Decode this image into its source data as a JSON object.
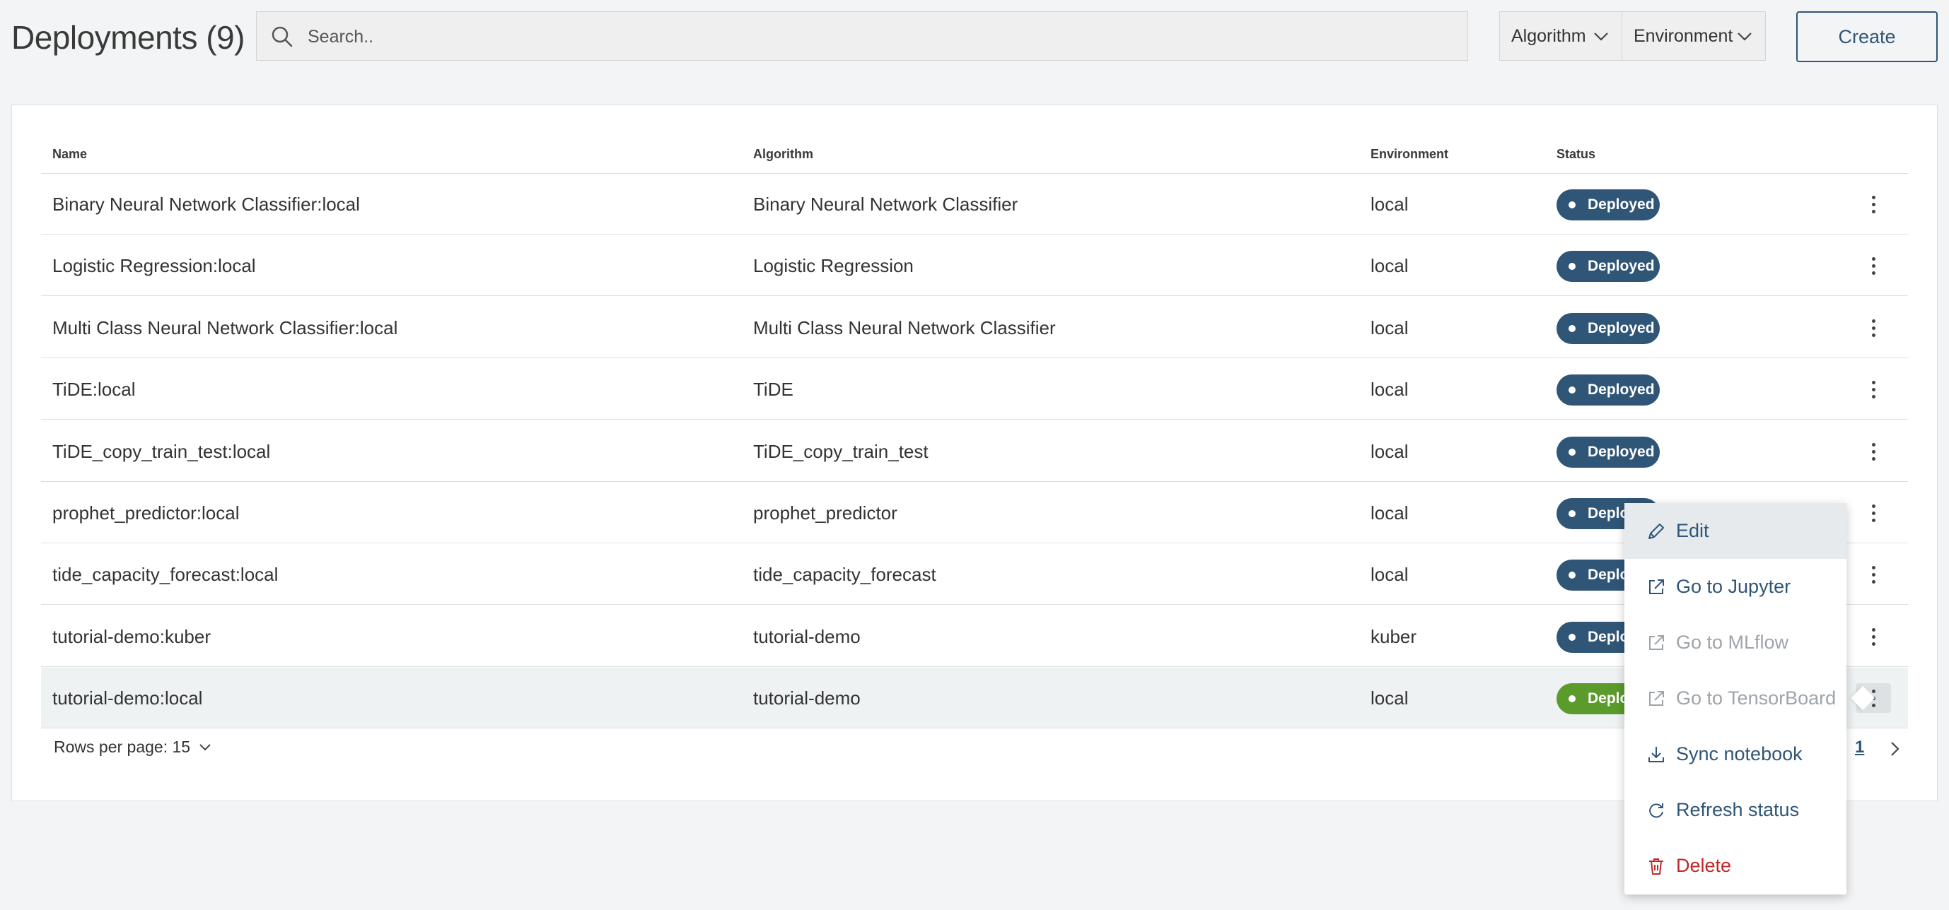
{
  "header": {
    "title": "Deployments (9)",
    "search_placeholder": "Search..",
    "filter_algorithm": "Algorithm",
    "filter_environment": "Environment",
    "create_label": "Create"
  },
  "table": {
    "columns": [
      "Name",
      "Algorithm",
      "Environment",
      "Status"
    ],
    "rows": [
      {
        "name": "Binary Neural Network Classifier:local",
        "algorithm": "Binary Neural Network Classifier",
        "environment": "local",
        "status": "Deployed"
      },
      {
        "name": "Logistic Regression:local",
        "algorithm": "Logistic Regression",
        "environment": "local",
        "status": "Deployed"
      },
      {
        "name": "Multi Class Neural Network Classifier:local",
        "algorithm": "Multi Class Neural Network Classifier",
        "environment": "local",
        "status": "Deployed"
      },
      {
        "name": "TiDE:local",
        "algorithm": "TiDE",
        "environment": "local",
        "status": "Deployed"
      },
      {
        "name": "TiDE_copy_train_test:local",
        "algorithm": "TiDE_copy_train_test",
        "environment": "local",
        "status": "Deployed"
      },
      {
        "name": "prophet_predictor:local",
        "algorithm": "prophet_predictor",
        "environment": "local",
        "status": "Deployed"
      },
      {
        "name": "tide_capacity_forecast:local",
        "algorithm": "tide_capacity_forecast",
        "environment": "local",
        "status": "Deployed"
      },
      {
        "name": "tutorial-demo:kuber",
        "algorithm": "tutorial-demo",
        "environment": "kuber",
        "status": "Deployed"
      },
      {
        "name": "tutorial-demo:local",
        "algorithm": "tutorial-demo",
        "environment": "local",
        "status": "Deployed"
      }
    ]
  },
  "footer": {
    "rows_per_page": "Rows per page: 15",
    "page": "1"
  },
  "context_menu": {
    "items": [
      {
        "label": "Edit",
        "icon": "pencil-icon"
      },
      {
        "label": "Go to Jupyter",
        "icon": "external-link-icon"
      },
      {
        "label": "Go to MLflow",
        "icon": "external-link-icon"
      },
      {
        "label": "Go to TensorBoard",
        "icon": "external-link-icon"
      },
      {
        "label": "Sync notebook",
        "icon": "download-icon"
      },
      {
        "label": "Refresh status",
        "icon": "refresh-icon"
      },
      {
        "label": "Delete",
        "icon": "trash-icon"
      }
    ]
  },
  "colors": {
    "accent": "#2f5577",
    "status_deployed": "#2f5577",
    "status_active": "#5a9b2c",
    "danger": "#c0282a",
    "disabled": "#9ea4aa"
  }
}
